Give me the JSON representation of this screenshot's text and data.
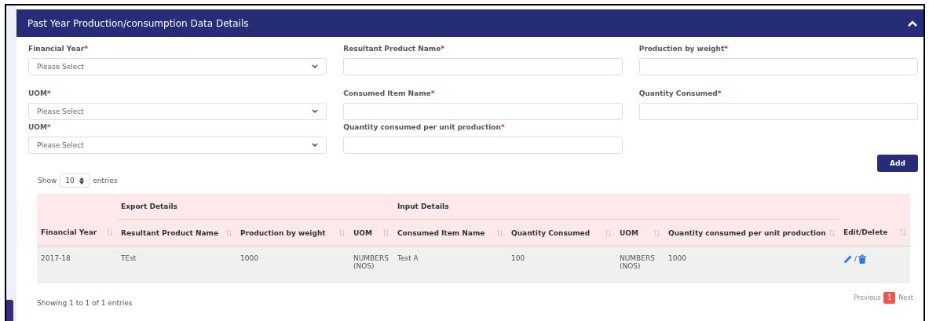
{
  "panel": {
    "title": "Past Year Production/consumption Data Details",
    "expanded": true
  },
  "form_rows": [
    [
      {
        "kind": "select",
        "label": "Financial Year",
        "required_mark": "*",
        "placeholder": "Please Select"
      },
      {
        "kind": "text",
        "label": "Resultant Product Name",
        "required_mark": "*"
      },
      {
        "kind": "text",
        "label": "Production by weight",
        "required_mark": "*"
      }
    ],
    [
      {
        "kind": "select",
        "label": "UOM",
        "required_mark": "*",
        "placeholder": "Please Select"
      },
      {
        "kind": "text",
        "label": "Consumed Item Name",
        "required_mark": "*"
      },
      {
        "kind": "text",
        "label": "Quantity Consumed",
        "required_mark": "*"
      }
    ],
    [
      {
        "kind": "select",
        "label": "UOM",
        "required_mark": "*",
        "placeholder": "Please Select"
      },
      {
        "kind": "text",
        "label": "Quantity consumed per unit production",
        "required_mark": "*"
      }
    ]
  ],
  "add_button": "Add",
  "length_menu": {
    "before": "Show",
    "value": "10",
    "after": "entries"
  },
  "table": {
    "groups": [
      {
        "label": "Export Details"
      },
      {
        "label": "Input Details"
      }
    ],
    "columns": [
      "Financial Year",
      "Resultant Product Name",
      "Production by weight",
      "UOM",
      "Consumed Item Name",
      "Quantity Consumed",
      "UOM",
      "Quantity consumed per unit production",
      "Edit/Delete"
    ],
    "rows": [
      {
        "cells": [
          "2017-18",
          "TEst",
          "1000",
          "NUMBERS (NOS)",
          "Test A",
          "100",
          "NUMBERS (NOS)",
          "1000"
        ],
        "separator": "/"
      }
    ]
  },
  "info": "Showing 1 to 1 of 1 entries",
  "pagination": {
    "previous": "Previous",
    "pages": [
      {
        "label": "1",
        "selected": true
      }
    ],
    "next": "Next"
  }
}
